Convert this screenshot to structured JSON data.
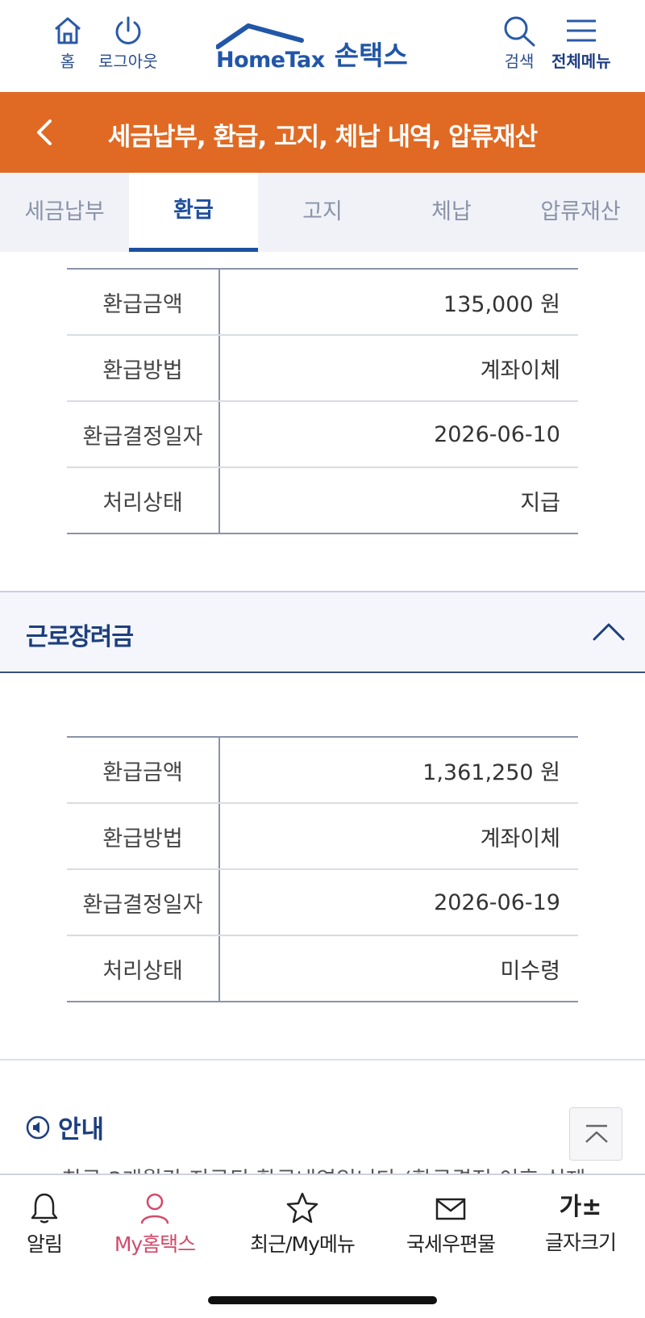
{
  "header": {
    "home_label": "홈",
    "logout_label": "로그아웃",
    "logo_en": "HomeTax",
    "logo_ko": "손택스",
    "search_label": "검색",
    "menu_label": "전체메뉴",
    "brand_color": "#2156a8"
  },
  "title_bar": {
    "title": "세금납부, 환급, 고지, 체납 내역, 압류재산",
    "color": "#e06a24"
  },
  "tabs": [
    {
      "label": "세금납부",
      "active": false
    },
    {
      "label": "환급",
      "active": true
    },
    {
      "label": "고지",
      "active": false
    },
    {
      "label": "체납",
      "active": false
    },
    {
      "label": "압류재산",
      "active": false
    }
  ],
  "refund_1": {
    "rows": [
      {
        "key": "환급금액",
        "value": "135,000 원"
      },
      {
        "key": "환급방법",
        "value": "계좌이체"
      },
      {
        "key": "환급결정일자",
        "value": "2026-06-10"
      },
      {
        "key": "처리상태",
        "value": "지급"
      }
    ]
  },
  "section": {
    "title": "근로장려금"
  },
  "refund_2": {
    "rows": [
      {
        "key": "환급금액",
        "value": "1,361,250 원"
      },
      {
        "key": "환급방법",
        "value": "계좌이체"
      },
      {
        "key": "환급결정일자",
        "value": "2026-06-19"
      },
      {
        "key": "처리상태",
        "value": "미수령"
      }
    ]
  },
  "notice": {
    "title": "안내",
    "body": "최근 3개월간 지급된 환급내역입니다.(환급결정 이후 실제"
  },
  "bottom_nav": [
    {
      "label": "알림",
      "icon": "bell-icon"
    },
    {
      "label": "My홈택스",
      "icon": "person-icon",
      "active": true
    },
    {
      "label": "최근/My메뉴",
      "icon": "star-icon"
    },
    {
      "label": "국세우편물",
      "icon": "mail-icon"
    },
    {
      "label": "글자크기",
      "icon": "font-size-icon",
      "glyph": "가±"
    }
  ]
}
